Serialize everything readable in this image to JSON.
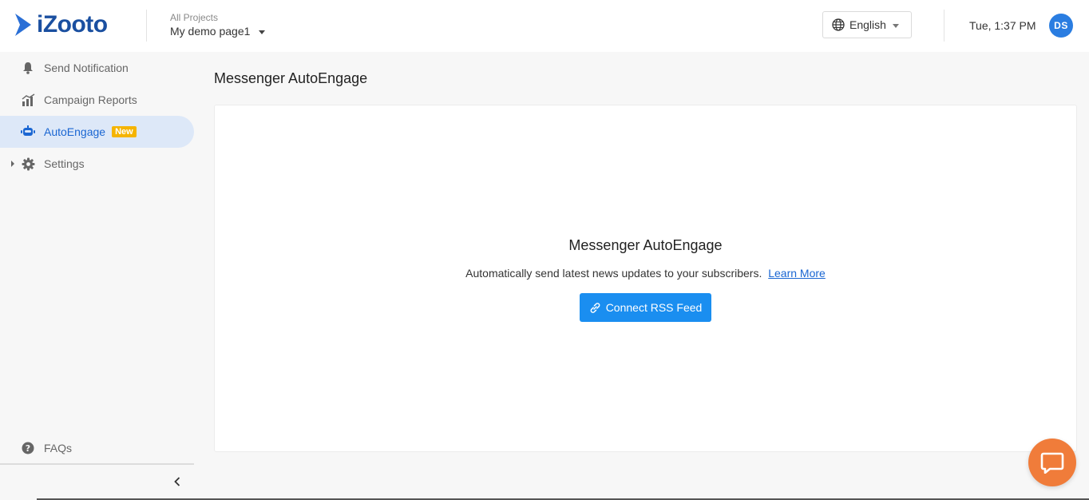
{
  "brand": {
    "name": "iZooto",
    "accent": "#1a4fa0",
    "arrow": "#2a6fd6"
  },
  "header": {
    "project_label": "All Projects",
    "project_name": "My demo page1",
    "language": "English",
    "time": "Tue, 1:37 PM",
    "user_initials": "DS"
  },
  "sidebar": {
    "items": [
      {
        "label": "Send Notification",
        "icon": "bell-icon"
      },
      {
        "label": "Campaign Reports",
        "icon": "bar-chart-icon"
      },
      {
        "label": "AutoEngage",
        "icon": "robot-icon",
        "badge": "New",
        "active": true
      },
      {
        "label": "Settings",
        "icon": "gear-icon",
        "expandable": true
      }
    ],
    "faq_label": "FAQs"
  },
  "main": {
    "page_title": "Messenger AutoEngage",
    "card": {
      "title": "Messenger AutoEngage",
      "description": "Automatically send latest news updates to your subscribers.",
      "learn_more": "Learn More",
      "cta_label": "Connect RSS Feed"
    }
  },
  "colors": {
    "active_bg": "#dde8f8",
    "active_text": "#1a66d2",
    "badge": "#f5b400",
    "cta": "#1a8ef0",
    "avatar": "#2a7de1",
    "chat": "#f07c3a"
  }
}
